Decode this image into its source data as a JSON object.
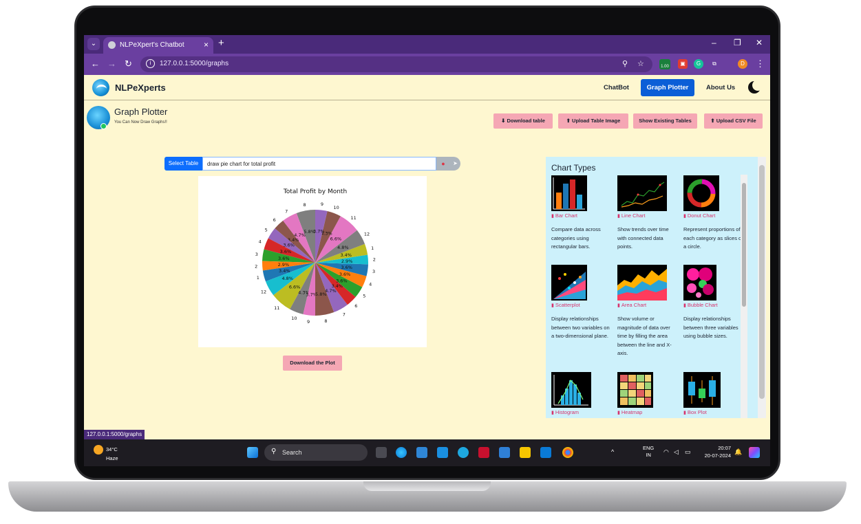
{
  "browser": {
    "tab_title": "NLPeXpert's Chatbot",
    "url": "127.0.0.1:5000/graphs",
    "status_url": "127.0.0.1:5000/graphs",
    "extension_badge": "1.00",
    "profile_initial": "D"
  },
  "app": {
    "brand": "NLPeXperts",
    "nav": {
      "chatbot": "ChatBot",
      "graph_plotter": "Graph Plotter",
      "about": "About Us"
    },
    "header": {
      "title": "Graph Plotter",
      "subtitle": "You Can Now Draw Graphs!!"
    },
    "actions": {
      "download_table": "⬇ Download table",
      "upload_image": "⬆ Upload Table Image",
      "show_tables": "Show Existing Tables",
      "upload_csv": "⬆ Upload CSV File"
    },
    "query": {
      "select_label": "Select Table",
      "value": "draw pie chart for total profit"
    },
    "download_plot": "Download the Plot"
  },
  "chart_types": {
    "title": "Chart Types",
    "items": [
      {
        "name": "Bar Chart",
        "desc": "Compare data across categories using rectangular bars."
      },
      {
        "name": "Line Chart",
        "desc": "Show trends over time with connected data points."
      },
      {
        "name": "Donut Chart",
        "desc": "Represent proportions of each category as slices of a circle."
      },
      {
        "name": "Scatterplot",
        "desc": "Display relationships between two variables on a two-dimensional plane."
      },
      {
        "name": "Area Chart",
        "desc": "Show volume or magnitude of data over time by filling the area between the line and X-axis."
      },
      {
        "name": "Bubble Chart",
        "desc": "Display relationships between three variables using bubble sizes."
      },
      {
        "name": "Histogram",
        "desc": ""
      },
      {
        "name": "Heatmap",
        "desc": ""
      },
      {
        "name": "Box Plot",
        "desc": ""
      }
    ]
  },
  "taskbar": {
    "temp": "34°C",
    "weather": "Haze",
    "search": "Search",
    "lang": "ENG",
    "region": "IN",
    "time": "20:07",
    "date": "20-07-2024"
  },
  "chart_data": {
    "type": "pie",
    "title": "Total Profit by Month",
    "categories": [
      "8",
      "7",
      "6",
      "5",
      "4",
      "3",
      "2",
      "1",
      "12",
      "11",
      "10",
      "9",
      "8",
      "7",
      "6",
      "5",
      "4",
      "3",
      "2",
      "1",
      "12",
      "11",
      "10",
      "9"
    ],
    "values": [
      5.8,
      4.7,
      3.4,
      3.6,
      3.6,
      3.6,
      2.9,
      3.4,
      4.8,
      6.6,
      4.3,
      3.7,
      5.8,
      4.7,
      3.4,
      3.6,
      3.6,
      3.6,
      2.9,
      3.4,
      4.8,
      6.6,
      4.3,
      3.7
    ],
    "labels": [
      "5.8%",
      "4.7%",
      "3.4%",
      "3.6%",
      "3.6%",
      "3.6%",
      "2.9%",
      "3.4%",
      "4.8%",
      "6.6%",
      "4.3%",
      "3.7%",
      "5.8%",
      "4.7%",
      "3.4%",
      "3.6%",
      "3.6%",
      "3.6%",
      "2.9%",
      "3.4%",
      "4.8%",
      "6.6%",
      "4.3%",
      "3.7%"
    ],
    "colors": [
      "#7f7f7f",
      "#e377c2",
      "#8c564b",
      "#9467bd",
      "#d62728",
      "#2ca02c",
      "#ff7f0e",
      "#1f77b4",
      "#17becf",
      "#bcbd22",
      "#7f7f7f",
      "#e377c2",
      "#8c564b",
      "#9467bd",
      "#d62728",
      "#2ca02c",
      "#ff7f0e",
      "#1f77b4",
      "#17becf",
      "#bcbd22",
      "#7f7f7f",
      "#e377c2",
      "#8c564b",
      "#9467bd"
    ]
  }
}
